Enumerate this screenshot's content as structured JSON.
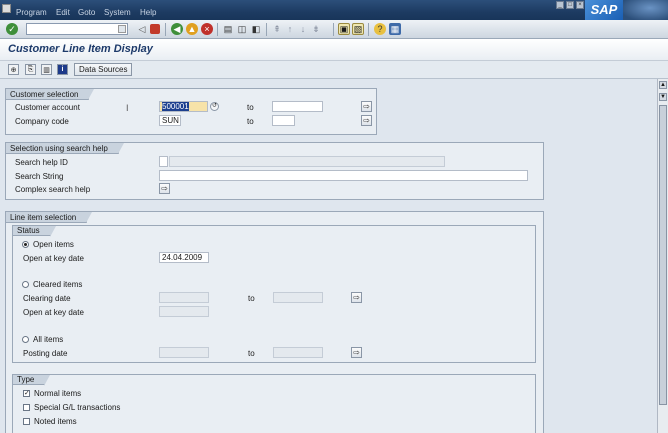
{
  "menu": {
    "items": [
      "Program",
      "Edit",
      "Goto",
      "System",
      "Help"
    ],
    "logo": "SAP"
  },
  "colors": {
    "menubar": "#1d3b62",
    "title": "#1d3a6a",
    "required_field": "#f7e3a9",
    "selection": "#1c3f8e"
  },
  "title": "Customer Line Item Display",
  "app_toolbar": {
    "data_sources_label": "Data Sources"
  },
  "customer_selection": {
    "title": "Customer selection",
    "customer_account_label": "Customer account",
    "customer_account_value": "500001",
    "to_label": "to",
    "company_code_label": "Company code",
    "company_code_value": "SUN"
  },
  "search_help": {
    "title": "Selection using search help",
    "search_help_id_label": "Search help ID",
    "search_string_label": "Search String",
    "complex_search_label": "Complex search help"
  },
  "line_item_selection": {
    "title": "Line item selection",
    "status": {
      "title": "Status",
      "open_items_label": "Open items",
      "open_at_key_date_label": "Open at key date",
      "open_at_key_date_value": "24.04.2009",
      "cleared_items_label": "Cleared items",
      "clearing_date_label": "Clearing date",
      "to_label": "to",
      "open_at_key_date2_label": "Open at key date",
      "all_items_label": "All items",
      "posting_date_label": "Posting date"
    },
    "type": {
      "title": "Type",
      "normal_items_label": "Normal items",
      "special_gl_label": "Special G/L transactions",
      "noted_items_label": "Noted items"
    }
  }
}
